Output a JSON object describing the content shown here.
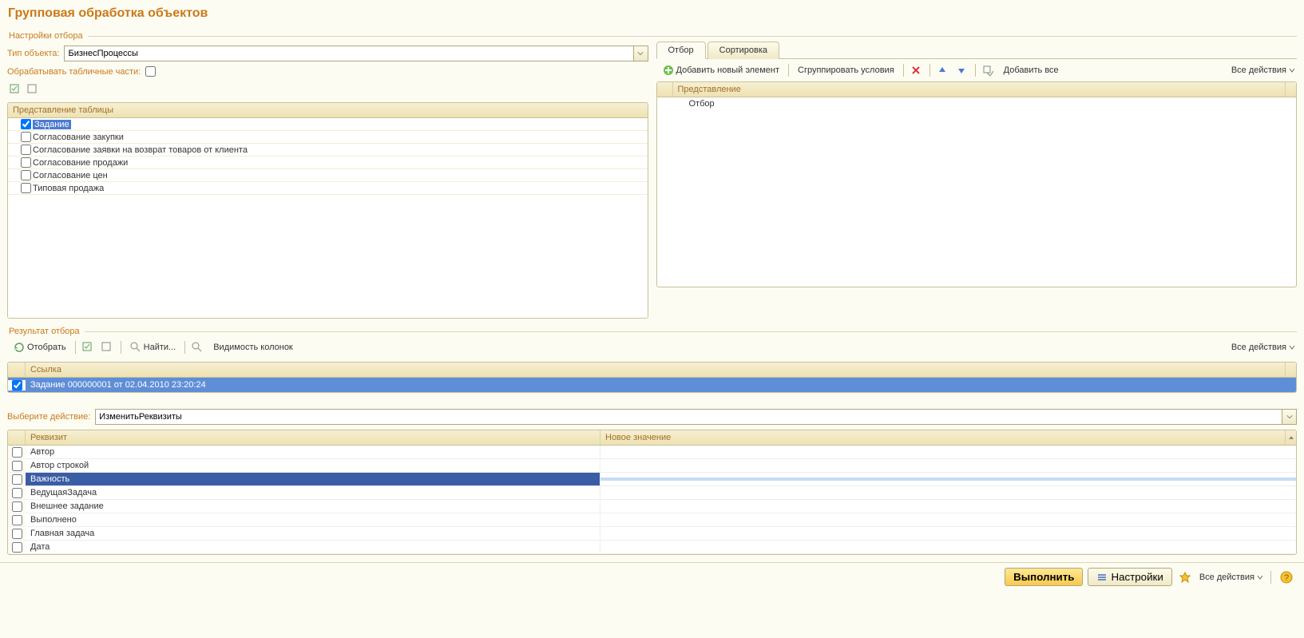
{
  "title": "Групповая обработка объектов",
  "section_filter": "Настройки отбора",
  "section_result": "Результат отбора",
  "labels": {
    "object_type": "Тип объекта:",
    "process_tabular": "Обрабатывать табличные части:",
    "select_action": "Выберите действие:"
  },
  "object_type_value": "БизнесПроцессы",
  "action_value": "ИзменитьРеквизиты",
  "table_view_header": "Представление таблицы",
  "table_view_items": [
    {
      "label": "Задание",
      "checked": true,
      "selected": true
    },
    {
      "label": "Согласование закупки",
      "checked": false
    },
    {
      "label": "Согласование заявки на возврат товаров от клиента",
      "checked": false
    },
    {
      "label": "Согласование продажи",
      "checked": false
    },
    {
      "label": "Согласование цен",
      "checked": false
    },
    {
      "label": "Типовая продажа",
      "checked": false
    }
  ],
  "tabs": {
    "filter": "Отбор",
    "sort": "Сортировка"
  },
  "filter_toolbar": {
    "add": "Добавить новый элемент",
    "group": "Сгруппировать условия",
    "add_all": "Добавить все",
    "all_actions": "Все действия"
  },
  "filter_header": "Представление",
  "filter_root": "Отбор",
  "result_toolbar": {
    "select": "Отобрать",
    "find": "Найти...",
    "columns": "Видимость колонок",
    "all_actions": "Все действия"
  },
  "result_header": "Ссылка",
  "result_rows": [
    {
      "label": "Задание 000000001 от 02.04.2010 23:20:24",
      "checked": true,
      "selected": true
    }
  ],
  "attr_header": {
    "name": "Реквизит",
    "value": "Новое значение"
  },
  "attr_rows": [
    {
      "name": "Автор"
    },
    {
      "name": "Автор строкой"
    },
    {
      "name": "Важность",
      "selected": true
    },
    {
      "name": "ВедущаяЗадача"
    },
    {
      "name": "Внешнее задание"
    },
    {
      "name": "Выполнено"
    },
    {
      "name": "Главная задача"
    },
    {
      "name": "Дата"
    }
  ],
  "bottom": {
    "execute": "Выполнить",
    "settings": "Настройки",
    "all_actions": "Все действия"
  }
}
